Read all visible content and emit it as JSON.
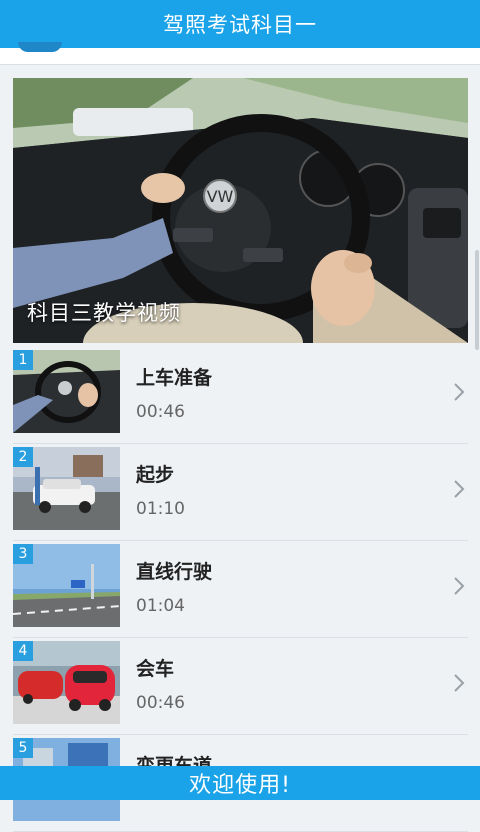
{
  "header": {
    "title": "驾照考试科目一"
  },
  "hero": {
    "title": "科目三教学视频"
  },
  "lessons": [
    {
      "number": "1",
      "title": "上车准备",
      "duration": "00:46"
    },
    {
      "number": "2",
      "title": "起步",
      "duration": "01:10"
    },
    {
      "number": "3",
      "title": "直线行驶",
      "duration": "01:04"
    },
    {
      "number": "4",
      "title": "会车",
      "duration": "00:46"
    },
    {
      "number": "5",
      "title": "变更车道",
      "duration": ""
    }
  ],
  "footer": {
    "text": "欢迎使用!"
  },
  "colors": {
    "accent": "#1aa3e8",
    "badge": "#2a9fe0"
  }
}
